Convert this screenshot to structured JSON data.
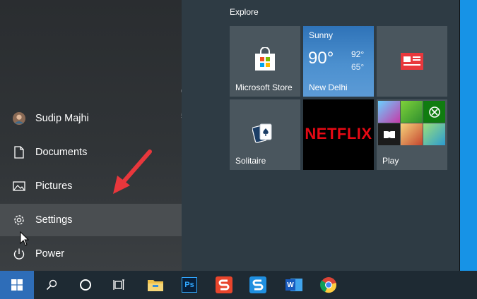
{
  "tiles_header": "Explore",
  "tiles": {
    "store": {
      "label": "Microsoft Store"
    },
    "weather": {
      "condition": "Sunny",
      "temp": "90°",
      "high": "92°",
      "low": "65°",
      "city": "New Delhi"
    },
    "news": {
      "label": ""
    },
    "solitaire": {
      "label": "Solitaire"
    },
    "netflix": {
      "label": "NETFLIX"
    },
    "play": {
      "label": "Play"
    }
  },
  "side_menu": {
    "user": "Sudip Majhi",
    "documents": "Documents",
    "pictures": "Pictures",
    "settings": "Settings",
    "power": "Power"
  },
  "fragments": [
    "6",
    "5"
  ],
  "taskbar": {
    "apps": [
      "start",
      "search",
      "cortana",
      "task-view",
      "file-explorer",
      "photoshop",
      "snagit-editor",
      "snagit",
      "word",
      "chrome"
    ],
    "photoshop_label": "Ps",
    "word_label": "W"
  },
  "colors": {
    "accent_blue": "#1793e6",
    "start_button": "#2e6db8",
    "arrow_red": "#e8373c",
    "netflix_red": "#e50914",
    "tile_gray": "#4a565e"
  }
}
